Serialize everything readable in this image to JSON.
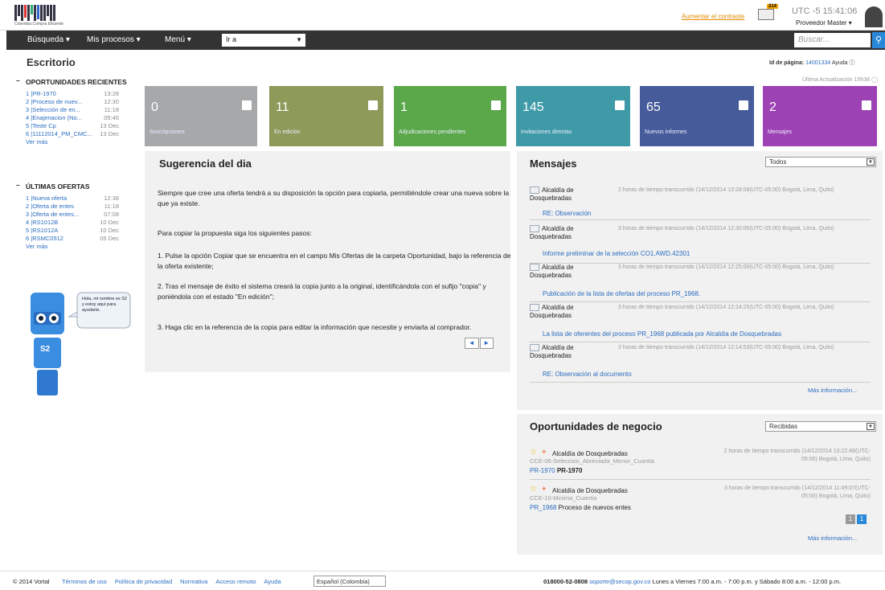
{
  "header": {
    "brand": "Colombia Compra Eficiente",
    "contrast_link": "Aumentar el contraste",
    "mail_badge": "214",
    "time": "UTC -5 15:41:06",
    "role": "Proveedor Master ▾"
  },
  "nav": {
    "busqueda": "Búsqueda ▾",
    "procesos": "Mis procesos ▾",
    "menu": "Menú ▾",
    "ira": "Ir a",
    "search_placeholder": "Buscar..."
  },
  "page": {
    "title": "Escritorio",
    "id_label": "Id de página:",
    "id_value": "14001334",
    "help": "Ayuda ⓘ",
    "last_update": "Última Actualización 15h38"
  },
  "recent": {
    "title": "OPORTUNIDADES RECIENTES",
    "items": [
      {
        "t": "1 |PR-1970",
        "d": "13:28"
      },
      {
        "t": "2 |Proceso de nuev...",
        "d": "12:30"
      },
      {
        "t": "3 |Selección de en...",
        "d": "11:18"
      },
      {
        "t": "4 |Enajenacion (No...",
        "d": "05:46"
      },
      {
        "t": "5 |Teste Cp",
        "d": "13 Dec"
      },
      {
        "t": "6 |11112014_PM_CMC...",
        "d": "13 Dec"
      }
    ],
    "more": "Ver más"
  },
  "offers": {
    "title": "ÚLTIMAS OFERTAS",
    "items": [
      {
        "t": "1 |Nueva oferta",
        "d": "12:38"
      },
      {
        "t": "2 |Oferta de entes",
        "d": "11:18"
      },
      {
        "t": "3 |Oferta de entes...",
        "d": "07:08"
      },
      {
        "t": "4 |RS1012B",
        "d": "10 Dec"
      },
      {
        "t": "5 |RS1012A",
        "d": "10 Dec"
      },
      {
        "t": "6 |RSMC0512",
        "d": "05 Dec"
      }
    ],
    "more": "Ver más"
  },
  "robot": {
    "bubble": "Hola, mi nombre es S2 y estoy aquí para ayudarte.",
    "label": "S2"
  },
  "tiles": [
    {
      "n": "0",
      "l": "Suscripciones",
      "color": "#a6a8aa"
    },
    {
      "n": "11",
      "l": "En edición",
      "color": "#8d9a5a"
    },
    {
      "n": "1",
      "l": "Adjudicaciones pendientes",
      "color": "#5aa84a"
    },
    {
      "n": "145",
      "l": "Invitaciones directas",
      "color": "#3f9aa8"
    },
    {
      "n": "65",
      "l": "Nuevos informes",
      "color": "#465b9a"
    },
    {
      "n": "2",
      "l": "Mensajes",
      "color": "#9d42b4"
    }
  ],
  "suggestion": {
    "title": "Sugerencia del dia",
    "p1": "Siempre que cree una oferta tendrá a su disposición la opción para copiarla, permitiéndole crear una nueva sobre la que ya existe.",
    "p2": "Para copiar la propuesta siga los siguientes pasos:",
    "p3": "1. Pulse la opción Copiar que se encuentra en el campo Mis Ofertas de la carpeta Oportunidad, bajo la referencia de la oferta existente;",
    "p4": "2. Tras el mensaje de éxito el sistema creará la copia junto a la original, identificándola con el sufijo \"copia\" y poniéndola con el estado \"En edición\";",
    "p5": "3. Haga clic en la referencia de la copia para editar la información que necesite y enviarla al comprador.",
    "prev": "◄",
    "next": "►"
  },
  "messages": {
    "title": "Mensajes",
    "filter": "Todos",
    "items": [
      {
        "from": "Alcaldía de Dosquebradas",
        "when": "2 horas de tiempo transcurrido (14/12/2014 13:28:08(UTC-05:00) Bogotá, Lima, Quito)",
        "subj": "RE: Observación"
      },
      {
        "from": "Alcaldía de Dosquebradas",
        "when": "3 horas de tiempo transcurrido (14/12/2014 12:30:06(UTC-05:00) Bogotá, Lima, Quito)",
        "subj": "Informe preliminar de la selección CO1.AWD.42301"
      },
      {
        "from": "Alcaldía de Dosquebradas",
        "when": "3 horas de tiempo transcurrido (14/12/2014 12:25:00(UTC-05:00) Bogotá, Lima, Quito)",
        "subj": "Publicación de la lista de ofertas del proceso PR_1968."
      },
      {
        "from": "Alcaldía de Dosquebradas",
        "when": "3 horas de tiempo transcurrido (14/12/2014 12:24:25(UTC-05:00) Bogotá, Lima, Quito)",
        "subj": "La lista de oferentes del proceso PR_1968 publicada por Alcaldía de Dosquebradas"
      },
      {
        "from": "Alcaldía de Dosquebradas",
        "when": "3 horas de tiempo transcurrido (14/12/2014 12:14:53(UTC-05:00) Bogotá, Lima, Quito)",
        "subj": "RE: Observación al documento"
      }
    ],
    "more": "Más información..."
  },
  "opportunities": {
    "title": "Oportunidades de negocio",
    "filter": "Recibidas",
    "items": [
      {
        "name": "Alcaldía de Dosquebradas",
        "code": "CCE-06-Seleccion_Abreviada_Menor_Cuantia",
        "ref": "PR-1970",
        "refname": "PR-1970",
        "when": "2 horas de tiempo transcurrido (14/12/2014 13:22:48(UTC-05:00) Bogotá, Lima, Quito)"
      },
      {
        "name": "Alcaldía de Dosquebradas",
        "code": "CCE-10-Minima_Cuantia",
        "ref": "PR_1968",
        "refname": "Proceso de nuevos entes",
        "when": "3 horas de tiempo transcurrido (14/12/2014 11:49:07(UTC-05:00) Bogotá, Lima, Quito)"
      }
    ],
    "pages": [
      "1",
      "1"
    ],
    "more": "Más información..."
  },
  "footer": {
    "copyright": "© 2014 Vortal",
    "links": [
      "Términos de uso",
      "Política de privacidad",
      "Normativa",
      "Acceso remoto",
      "Ayuda"
    ],
    "lang": "Español (Colombia)",
    "phone": "018000-52-0808",
    "email": "soporte@secop.gov.co",
    "hours": "Lunes a Viernes 7:00 a.m. - 7:00 p.m. y Sábado 8:00 a.m. - 12:00 p.m."
  }
}
